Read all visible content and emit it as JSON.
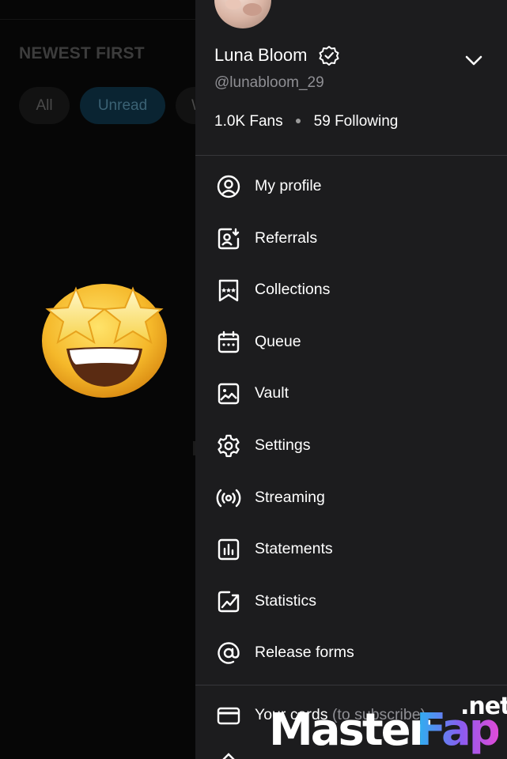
{
  "background": {
    "section_title": "NEWEST FIRST",
    "chips": [
      {
        "label": "All"
      },
      {
        "label": "Unread"
      },
      {
        "label": "W"
      }
    ],
    "emoji": "star-struck-emoji"
  },
  "profile": {
    "name": "Luna Bloom",
    "handle": "@lunabloom_29",
    "fans_count": "1.0K",
    "fans_label": "Fans",
    "following_count": "59",
    "following_label": "Following"
  },
  "menu": {
    "items": [
      {
        "label": "My profile",
        "icon": "user-circle-icon"
      },
      {
        "label": "Referrals",
        "icon": "user-add-icon"
      },
      {
        "label": "Collections",
        "icon": "bookmark-stars-icon"
      },
      {
        "label": "Queue",
        "icon": "calendar-icon"
      },
      {
        "label": "Vault",
        "icon": "image-icon"
      },
      {
        "label": "Settings",
        "icon": "gear-icon"
      },
      {
        "label": "Streaming",
        "icon": "broadcast-icon"
      },
      {
        "label": "Statements",
        "icon": "bar-chart-icon"
      },
      {
        "label": "Statistics",
        "icon": "line-chart-icon"
      },
      {
        "label": "Release forms",
        "icon": "at-sign-icon"
      }
    ],
    "cards_label": "Your cards",
    "cards_sub": "(to subscribe)"
  },
  "watermark": {
    "master": "Master",
    "fap": "Fap",
    "net": ".net"
  },
  "colors": {
    "drawer_bg": "#1c1c1e",
    "page_bg": "#060606",
    "divider": "#36363a",
    "muted_text": "#8f8f94",
    "unread_chip_bg": "#0a2432"
  }
}
